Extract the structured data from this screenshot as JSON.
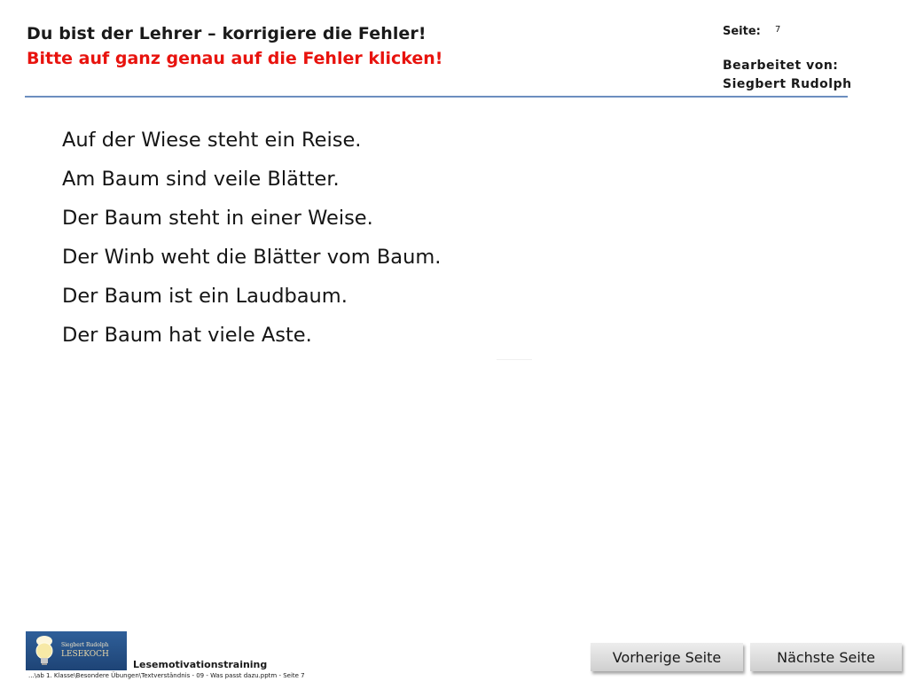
{
  "header": {
    "title": "Du bist der Lehrer – korrigiere die Fehler!",
    "subtitle": "Bitte auf ganz genau auf die Fehler klicken!",
    "page_label": "Seite:",
    "page_number": "7",
    "edited_label": "Bearbeitet von:",
    "edited_name": "Siegbert Rudolph"
  },
  "sentences": [
    {
      "words": [
        "Auf",
        "der",
        "Wiese",
        "steht",
        "ein",
        "Reise."
      ]
    },
    {
      "words": [
        "Am",
        "Baum",
        "sind",
        "veile",
        "Blätter."
      ]
    },
    {
      "words": [
        "Der",
        "Baum",
        "steht",
        "in",
        "einer",
        "Weise."
      ]
    },
    {
      "words": [
        "Der",
        "Winb",
        "weht",
        "die",
        "Blätter",
        "vom",
        "Baum."
      ]
    },
    {
      "words": [
        "Der",
        "Baum",
        "ist",
        "ein",
        "Laudbaum."
      ]
    },
    {
      "words": [
        "Der",
        "Baum",
        "hat",
        "viele",
        "Aste."
      ]
    }
  ],
  "footer": {
    "logo_author": "Siegbert Rudolph",
    "logo_brand": "LESEKOCH",
    "app_title": "Lesemotivationstraining",
    "file_path": "...\\ab 1. Klasse\\Besondere Übungen\\Textverständnis - 09 - Was passt dazu.pptm - Seite 7",
    "prev_label": "Vorherige Seite",
    "next_label": "Nächste Seite"
  },
  "colors": {
    "subtitle": "#e8130e",
    "header_line": "#6c8ebf",
    "logo_bg": "#2f5f99"
  },
  "icons": {
    "logo": "lightbulb-chef-logo-icon"
  }
}
